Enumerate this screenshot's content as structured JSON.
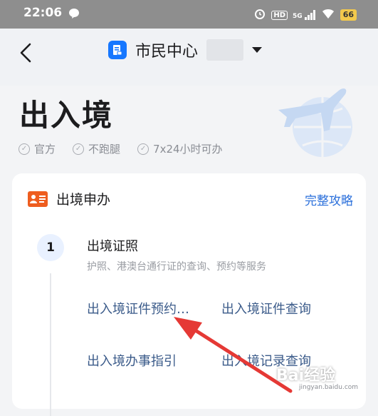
{
  "status_bar": {
    "time": "22:06",
    "signal_label": "5G",
    "battery": "66"
  },
  "header": {
    "title": "市民中心"
  },
  "hero": {
    "title": "出入境",
    "tags": [
      "官方",
      "不跑腿",
      "7x24小时可办"
    ]
  },
  "card": {
    "title": "出境申办",
    "link": "完整攻略",
    "step": {
      "number": "1",
      "title": "出境证照",
      "description": "护照、港澳台通行证的查询、预约等服务",
      "services": [
        "出入境证件预约…",
        "出入境证件查询",
        "出入境办事指引",
        "出入境记录查询"
      ]
    }
  },
  "watermark": {
    "brand": "Bai经验",
    "url": "jingyan.baidu.com"
  },
  "colors": {
    "accent": "#1677ff",
    "link": "#2a6fdb",
    "annotation_arrow": "#e53935",
    "id_icon": "#ee5d1f"
  }
}
